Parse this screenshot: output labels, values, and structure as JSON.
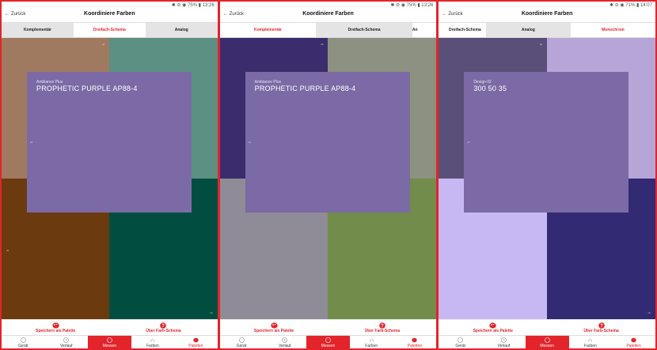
{
  "panels": [
    {
      "status": "✱ ⊘ ◉ 75% ▮ 13:26",
      "back_label": "Zurück",
      "title": "Koordiniere Farben",
      "tabs": [
        {
          "label": "Komplementär",
          "style": "grey"
        },
        {
          "label": "Dreifach-Schema",
          "style": "active"
        },
        {
          "label": "Analog",
          "style": "grey"
        }
      ],
      "colors": [
        "#a07a60",
        "#5b9082",
        "#6b3a0f",
        "#014e41"
      ],
      "tile_codes": [
        "nb",
        "",
        "nb",
        "nb"
      ],
      "card": {
        "color": "#7b6aa5",
        "brand": "Ambiance Plus",
        "name": "PROPHETIC PURPLE AP88-4",
        "code": "nb"
      },
      "actions": [
        {
          "label": "Speichern als Palette",
          "icon": "palette-icon"
        },
        {
          "label": "Über Farb-Schema",
          "icon": "help-icon"
        }
      ],
      "nav": [
        {
          "label": "Gerät"
        },
        {
          "label": "Verlauf"
        },
        {
          "label": "Messen"
        },
        {
          "label": "Farben"
        },
        {
          "label": "Paletten"
        }
      ]
    },
    {
      "status": "✱ ⊘ ◉ 75% ▮ 13:26",
      "back_label": "Zurück",
      "title": "Koordiniere Farben",
      "tabs": [
        {
          "label": "Komplementär",
          "style": "active"
        },
        {
          "label": "Dreifach-Schema",
          "style": "grey"
        },
        {
          "label": "An",
          "style": "plain"
        }
      ],
      "colors": [
        "#3b2c6d",
        "#8c9181",
        "#8f8b97",
        "#718c4b"
      ],
      "tile_codes": [
        "nb",
        "",
        "",
        ""
      ],
      "card": {
        "color": "#7b6aa5",
        "brand": "Ambiance Plus",
        "name": "PROPHETIC PURPLE AP88-4",
        "code": "nb"
      },
      "actions": [
        {
          "label": "Speichern als Palette",
          "icon": "palette-icon"
        },
        {
          "label": "Über Farb-Schema",
          "icon": "help-icon"
        }
      ],
      "nav": [
        {
          "label": "Gerät"
        },
        {
          "label": "Verlauf"
        },
        {
          "label": "Messen"
        },
        {
          "label": "Farben"
        },
        {
          "label": "Paletten"
        }
      ]
    },
    {
      "status": "✱ ⊘ ◉ 71% ▮ 14:07",
      "back_label": "Zurück",
      "title": "Koordiniere Farben",
      "tabs": [
        {
          "label": "Dreifach-Schema",
          "style": "plain"
        },
        {
          "label": "Analog",
          "style": "grey"
        },
        {
          "label": "Monochrom",
          "style": "active"
        }
      ],
      "colors": [
        "#5a4f79",
        "#b6a6d8",
        "#c7b8f3",
        "#322a72"
      ],
      "tile_codes": [
        "nb",
        "",
        "",
        "nb"
      ],
      "card": {
        "color": "#7b6aa5",
        "brand": "Design 02",
        "name": "300 50 35",
        "code": "nb"
      },
      "actions": [
        {
          "label": "Speichern als Palette",
          "icon": "palette-icon"
        },
        {
          "label": "Über Farb-Schema",
          "icon": "help-icon"
        }
      ],
      "nav": [
        {
          "label": "Gerät"
        },
        {
          "label": "Verlauf"
        },
        {
          "label": "Messen"
        },
        {
          "label": "Farben"
        },
        {
          "label": "Paletten"
        }
      ]
    }
  ]
}
